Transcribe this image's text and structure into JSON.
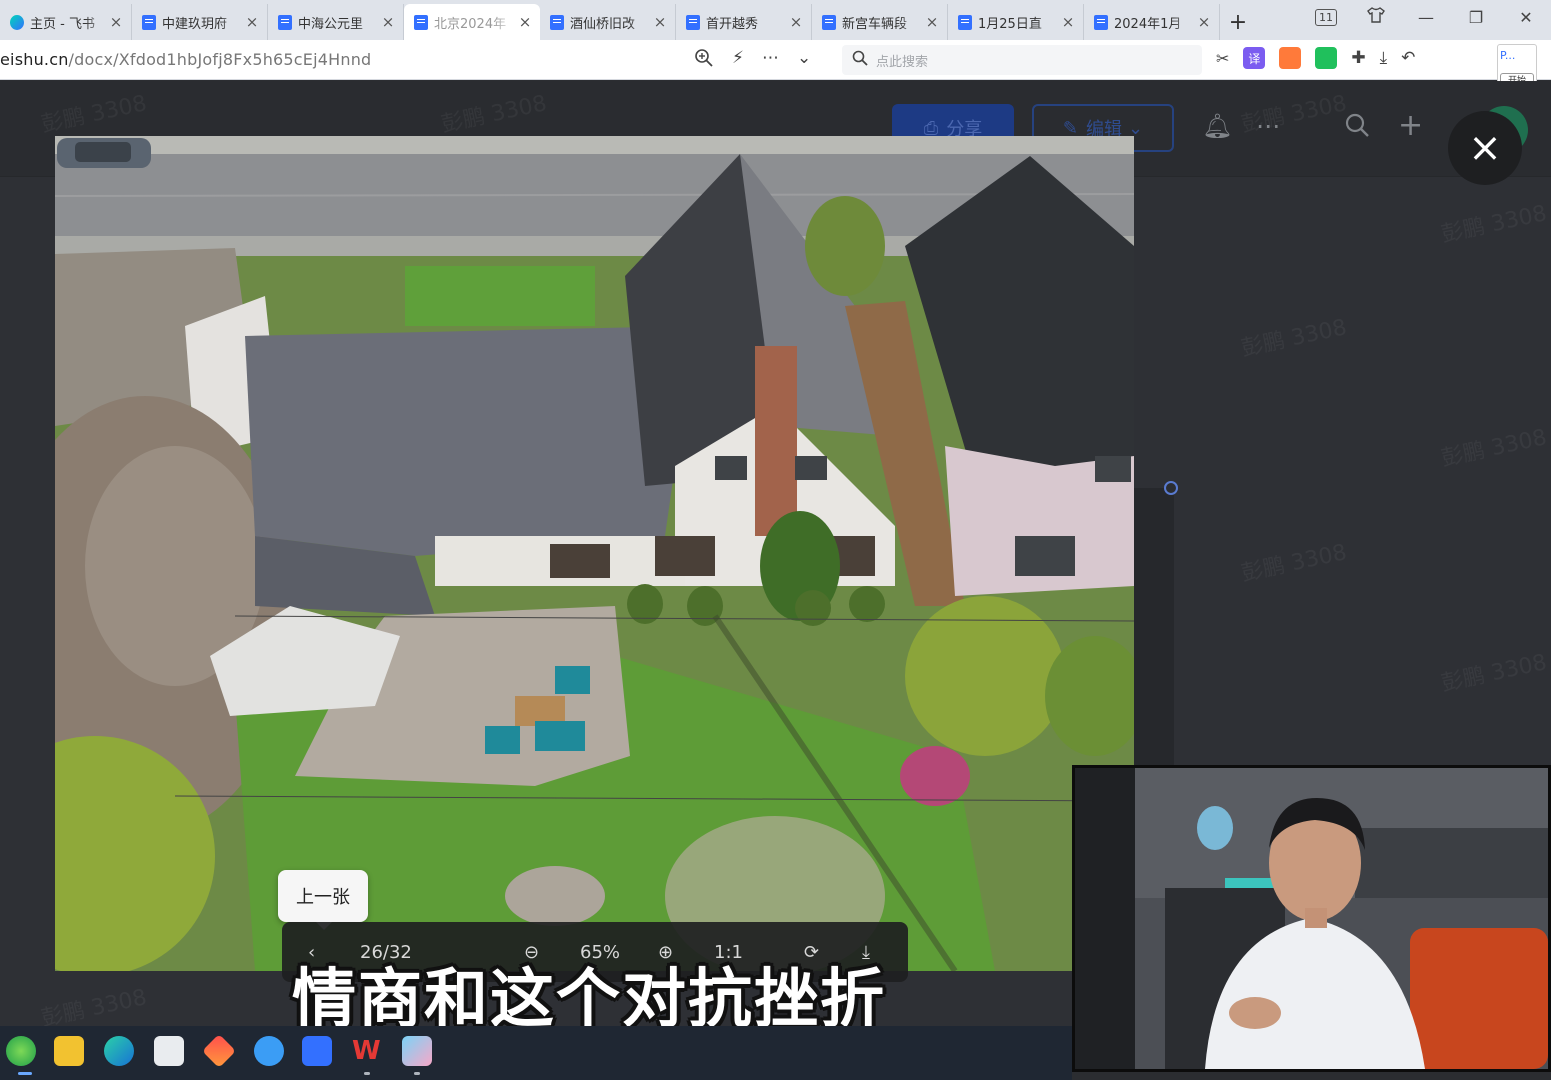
{
  "browser": {
    "tabs": [
      {
        "title": "主页 - 飞书",
        "icon": "home-logo",
        "active": false
      },
      {
        "title": "中建玖玥府",
        "icon": "doc-icon",
        "active": false
      },
      {
        "title": "中海公元里",
        "icon": "doc-icon",
        "active": false
      },
      {
        "title": "北京2024年",
        "icon": "doc-icon",
        "active": true
      },
      {
        "title": "酒仙桥旧改",
        "icon": "doc-icon",
        "active": false
      },
      {
        "title": "首开越秀",
        "icon": "doc-icon",
        "active": false
      },
      {
        "title": "新宫车辆段",
        "icon": "doc-icon",
        "active": false
      },
      {
        "title": "1月25日直",
        "icon": "doc-icon",
        "active": false
      },
      {
        "title": "2024年1月",
        "icon": "doc-icon",
        "active": false
      }
    ],
    "tab_close": "×",
    "new_tab": "+",
    "tab_counter": "11",
    "url_host": "eishu.cn",
    "url_path": "/docx/Xfdod1hbJofj8Fx5h65cEj4Hnnd",
    "search_placeholder": "点此搜索",
    "profile_label": "P...",
    "profile_button": "开始"
  },
  "document": {
    "share_label": "分享",
    "edit_label": "编辑",
    "watermark": "彭鹏 3308"
  },
  "viewer": {
    "close_icon": "×",
    "prev_tooltip": "上一张",
    "counter": "26/32",
    "zoom": "65%",
    "ratio_label": "1:1"
  },
  "subtitle": "情商和这个对抗挫折",
  "colors": {
    "accent": "#3370ff",
    "tab_strip": "#dfe3ea",
    "overlay": "#2e3035",
    "taskbar": "#1f2733"
  }
}
